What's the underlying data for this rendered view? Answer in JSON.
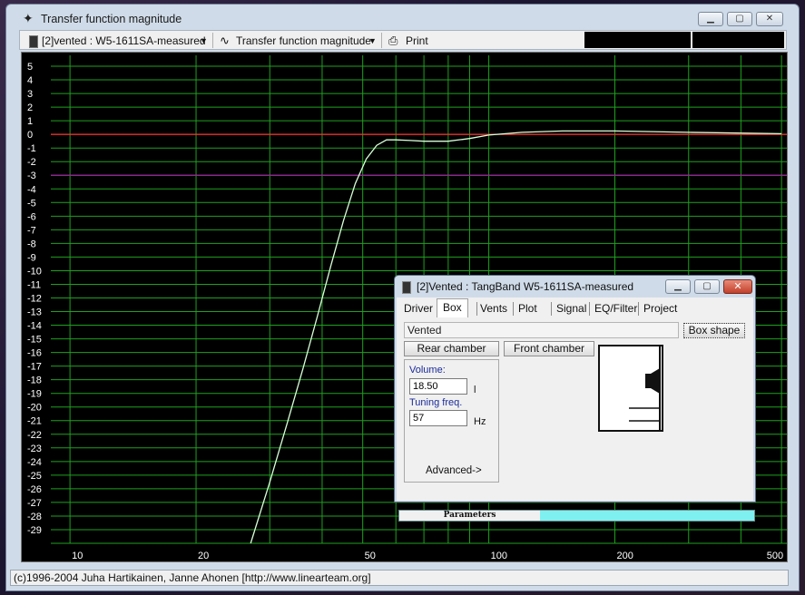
{
  "window": {
    "title": "Transfer function magnitude"
  },
  "toolbar": {
    "project_select": "[2]vented : W5-1611SA-measured",
    "plot_select": "Transfer function magnitude",
    "print_label": "Print"
  },
  "status": {
    "text": "(c)1996-2004 Juha Hartikainen, Janne Ahonen [http://www.linearteam.org]"
  },
  "dialog": {
    "title": "[2]Vented : TangBand W5-1611SA-measured",
    "tabs": [
      "Driver",
      "Box",
      "Vents",
      "Plot",
      "Signal",
      "EQ/Filter",
      "Project"
    ],
    "active_tab": "Box",
    "box_type": "Vented",
    "box_shape_label": "Box shape",
    "rear_chamber_label": "Rear chamber",
    "front_chamber_label": "Front chamber",
    "volume_label": "Volume:",
    "volume_value": "18.50",
    "volume_unit": "l",
    "tuning_label": "Tuning freq.",
    "tuning_value": "57",
    "tuning_unit": "Hz",
    "advanced_label": "Advanced->",
    "progress_label": "Parameters"
  },
  "chart_data": {
    "type": "line",
    "xscale": "log",
    "xlim": [
      9,
      520
    ],
    "ylim": [
      -30,
      5.8
    ],
    "x_ticks": [
      10,
      20,
      50,
      100,
      200,
      500
    ],
    "y_ticks": [
      5,
      4,
      3,
      2,
      1,
      0,
      -1,
      -2,
      -3,
      -4,
      -5,
      -6,
      -7,
      -8,
      -9,
      -10,
      -11,
      -12,
      -13,
      -14,
      -15,
      -16,
      -17,
      -18,
      -19,
      -20,
      -21,
      -22,
      -23,
      -24,
      -25,
      -26,
      -27,
      -28,
      -29
    ],
    "grid": true,
    "reference_lines": [
      {
        "y": 0,
        "color": "#ff3030"
      },
      {
        "y": -3,
        "color": "#a020a0"
      }
    ],
    "series": [
      {
        "color": "#d8ffd8",
        "x": [
          27,
          30,
          33,
          36,
          39,
          42,
          45,
          48,
          51,
          54,
          57,
          60,
          65,
          70,
          80,
          90,
          100,
          120,
          150,
          200,
          300,
          500
        ],
        "y": [
          -30,
          -25.5,
          -21.2,
          -17.2,
          -13.3,
          -9.6,
          -6.3,
          -3.6,
          -1.8,
          -0.8,
          -0.4,
          -0.4,
          -0.45,
          -0.5,
          -0.5,
          -0.3,
          -0.05,
          0.15,
          0.25,
          0.25,
          0.15,
          0.05
        ]
      }
    ],
    "colors": {
      "background": "#000000",
      "grid": "#1fa01f",
      "tick_label": "#ffffff"
    }
  }
}
